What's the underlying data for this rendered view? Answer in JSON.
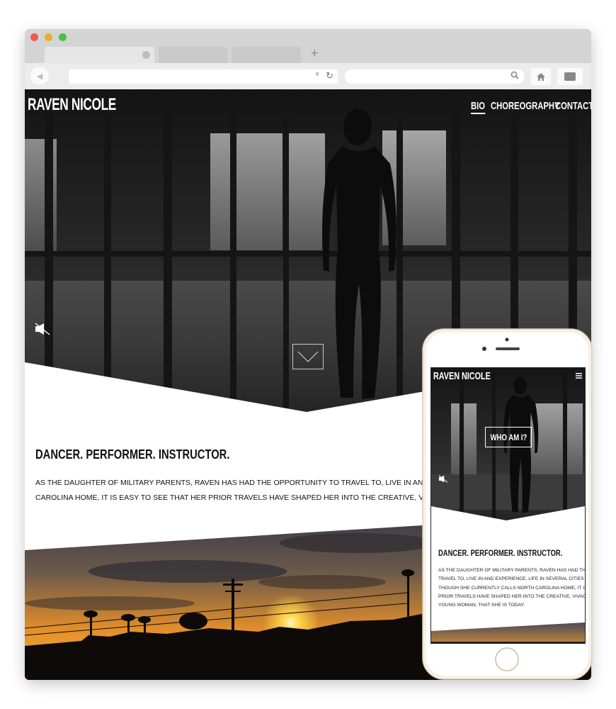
{
  "browser": {
    "tabs": [
      {
        "label": ""
      },
      {
        "label": ""
      },
      {
        "label": ""
      }
    ],
    "new_tab_glyph": "+",
    "url": "",
    "search_query": ""
  },
  "site": {
    "brand": "RAVEN NICOLE",
    "nav": [
      {
        "label": "BIO",
        "active": true
      },
      {
        "label": "CHOREOGRAPHY",
        "active": false
      },
      {
        "label": "CONTACT",
        "active": false
      }
    ],
    "headline": "DANCER. PERFORMER. INSTRUCTOR.",
    "bio_lines": [
      "AS THE DAUGHTER OF MILITARY PARENTS, RAVEN HAS HAD THE OPPORTUNITY TO TRAVEL TO, LIVE IN AND EXPERIENCE, LIFE IN SEVERAL CITIES THROUGHOUT THE US. THOUGH SHE CURRENTLY CALLS NORTH",
      "CAROLINA HOME, IT IS EASY TO SEE THAT HER PRIOR TRAVELS HAVE SHAPED HER INTO THE CREATIVE, VIVACIOUS, PASSIONATE, YOUNG WOMAN, THAT SHE IS TODAY."
    ]
  },
  "mobile": {
    "brand": "RAVEN NICOLE",
    "cta": "WHO AM I?",
    "headline": "DANCER. PERFORMER. INSTRUCTOR.",
    "bio_lines": [
      "AS THE DAUGHTER OF MILITARY PARENTS, RAVEN HAS HAD THE OPPORTUNITY TO",
      "TRAVEL TO, LIVE IN AND EXPERIENCE, LIFE IN SEVERAL CITIES THROUGHOUT THE US.",
      "THOUGH SHE CURRENTLY CALLS NORTH CAROLINA HOME, IT IS EASY TO SEE THAT HER",
      "PRIOR TRAVELS HAVE SHAPED HER INTO THE CREATIVE, VIVACIOUS, PASSIONATE,",
      "YOUNG WOMAN, THAT SHE IS TODAY."
    ]
  },
  "icons": {
    "back": "back-arrow-icon",
    "reload": "reload-icon",
    "search": "search-icon",
    "home": "home-icon",
    "mute": "speaker-muted-icon",
    "scroll_down": "chevron-down-icon",
    "menu": "hamburger-menu-icon"
  },
  "colors": {
    "hero_dark": "#1c1c1c",
    "text": "#111111",
    "sunset_orange": "#f2a630",
    "phone_frame": "#f3ece0"
  }
}
